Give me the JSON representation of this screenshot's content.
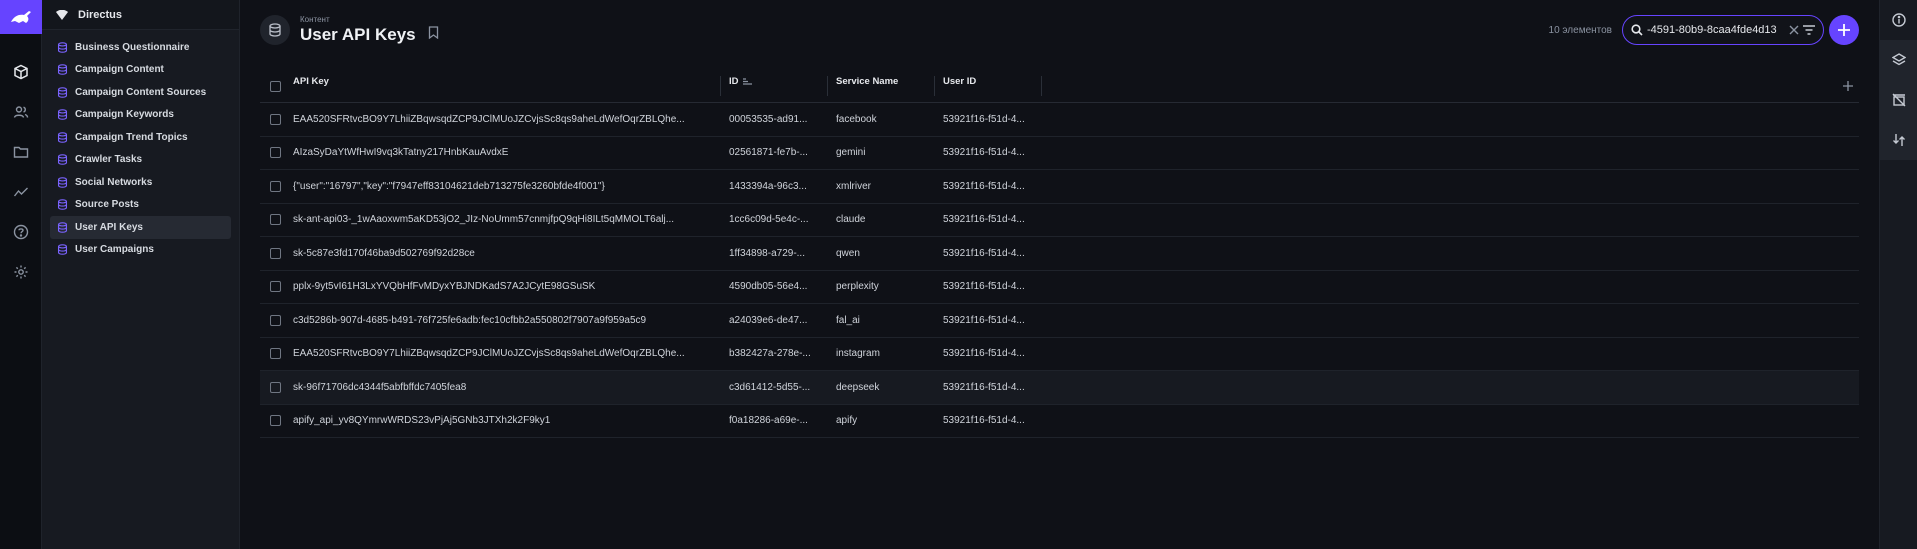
{
  "project": {
    "name": "Directus"
  },
  "modules": [
    {
      "icon": "box-icon",
      "active": true
    },
    {
      "icon": "users-icon",
      "active": false
    },
    {
      "icon": "folder-icon",
      "active": false
    },
    {
      "icon": "insights-icon",
      "active": false
    },
    {
      "icon": "help-icon",
      "active": false
    },
    {
      "icon": "settings-icon",
      "active": false
    }
  ],
  "nav": {
    "items": [
      {
        "label": "Business Questionnaire"
      },
      {
        "label": "Campaign Content"
      },
      {
        "label": "Campaign Content Sources"
      },
      {
        "label": "Campaign Keywords"
      },
      {
        "label": "Campaign Trend Topics"
      },
      {
        "label": "Crawler Tasks"
      },
      {
        "label": "Social Networks"
      },
      {
        "label": "Source Posts"
      },
      {
        "label": "User API Keys",
        "active": true
      },
      {
        "label": "User Campaigns"
      }
    ]
  },
  "header": {
    "breadcrumb": "Контент",
    "title": "User API Keys",
    "item_count": "10 элементов",
    "search_value": "-4591-80b9-8caa4fde4d13"
  },
  "table": {
    "columns": {
      "api_key": "API Key",
      "id": "ID",
      "service_name": "Service Name",
      "user_id": "User ID"
    },
    "rows": [
      {
        "api_key": "EAA520SFRtvcBO9Y7LhiiZBqwsqdZCP9JClMUoJZCvjsSc8qs9aheLdWefOqrZBLQhe...",
        "id": "00053535-ad91...",
        "service": "facebook",
        "user_id": "53921f16-f51d-4..."
      },
      {
        "api_key": "AIzaSyDaYtWfHwI9vq3kTatny217HnbKauAvdxE",
        "id": "02561871-fe7b-...",
        "service": "gemini",
        "user_id": "53921f16-f51d-4..."
      },
      {
        "api_key": "{\"user\":\"16797\",\"key\":\"f7947eff83104621deb713275fe3260bfde4f001\"}",
        "id": "1433394a-96c3...",
        "service": "xmlriver",
        "user_id": "53921f16-f51d-4..."
      },
      {
        "api_key": "sk-ant-api03-_1wAaoxwm5aKD53jO2_JIz-NoUmm57cnmjfpQ9qHi8ILt5qMMOLT6alj...",
        "id": "1cc6c09d-5e4c-...",
        "service": "claude",
        "user_id": "53921f16-f51d-4..."
      },
      {
        "api_key": "sk-5c87e3fd170f46ba9d502769f92d28ce",
        "id": "1ff34898-a729-...",
        "service": "qwen",
        "user_id": "53921f16-f51d-4..."
      },
      {
        "api_key": "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",
        "id": "4590db05-56e4...",
        "service": "perplexity",
        "user_id": "53921f16-f51d-4..."
      },
      {
        "api_key": "c3d5286b-907d-4685-b491-76f725fe6adb:fec10cfbb2a550802f7907a9f959a5c9",
        "id": "a24039e6-de47...",
        "service": "fal_ai",
        "user_id": "53921f16-f51d-4..."
      },
      {
        "api_key": "EAA520SFRtvcBO9Y7LhiiZBqwsqdZCP9JClMUoJZCvjsSc8qs9aheLdWefOqrZBLQhe...",
        "id": "b382427a-278e-...",
        "service": "instagram",
        "user_id": "53921f16-f51d-4..."
      },
      {
        "api_key": "sk-96f71706dc4344f5abfbffdc7405fea8",
        "id": "c3d61412-5d55-...",
        "service": "deepseek",
        "user_id": "53921f16-f51d-4..."
      },
      {
        "api_key": "apify_api_yv8QYmrwWRDS23vPjAj5GNb3JTXh2k2F9ky1",
        "id": "f0a18286-a69e-...",
        "service": "apify",
        "user_id": "53921f16-f51d-4..."
      }
    ]
  },
  "colors": {
    "accent": "#6644ff",
    "background": "#0f1117",
    "nav_bg": "#171a21"
  }
}
